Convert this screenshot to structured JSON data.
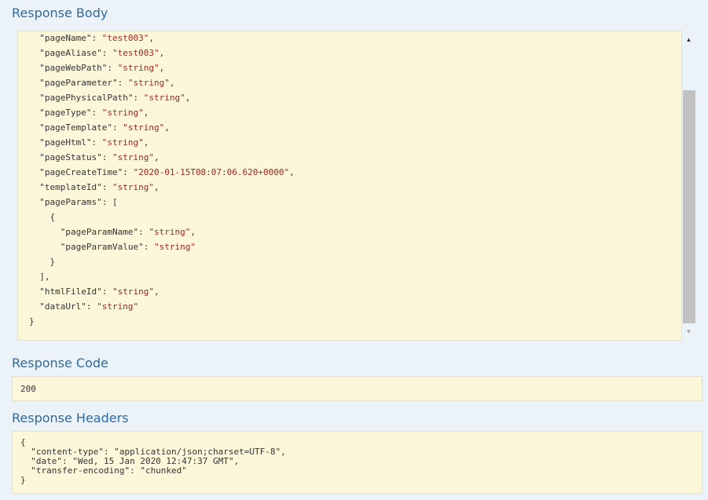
{
  "response_body": {
    "title": "Response Body",
    "lines": [
      {
        "indent": "  ",
        "key": "\"pageName\"",
        "sep": ": ",
        "value": "\"test003\"",
        "end": ","
      },
      {
        "indent": "  ",
        "key": "\"pageAliase\"",
        "sep": ": ",
        "value": "\"test003\"",
        "end": ","
      },
      {
        "indent": "  ",
        "key": "\"pageWebPath\"",
        "sep": ": ",
        "value": "\"string\"",
        "end": ","
      },
      {
        "indent": "  ",
        "key": "\"pageParameter\"",
        "sep": ": ",
        "value": "\"string\"",
        "end": ","
      },
      {
        "indent": "  ",
        "key": "\"pagePhysicalPath\"",
        "sep": ": ",
        "value": "\"string\"",
        "end": ","
      },
      {
        "indent": "  ",
        "key": "\"pageType\"",
        "sep": ": ",
        "value": "\"string\"",
        "end": ","
      },
      {
        "indent": "  ",
        "key": "\"pageTemplate\"",
        "sep": ": ",
        "value": "\"string\"",
        "end": ","
      },
      {
        "indent": "  ",
        "key": "\"pageHtml\"",
        "sep": ": ",
        "value": "\"string\"",
        "end": ","
      },
      {
        "indent": "  ",
        "key": "\"pageStatus\"",
        "sep": ": ",
        "value": "\"string\"",
        "end": ","
      },
      {
        "indent": "  ",
        "key": "\"pageCreateTime\"",
        "sep": ": ",
        "value": "\"2020-01-15T08:07:06.620+0000\"",
        "end": ","
      },
      {
        "indent": "  ",
        "key": "\"templateId\"",
        "sep": ": ",
        "value": "\"string\"",
        "end": ","
      },
      {
        "indent": "  ",
        "key": "\"pageParams\"",
        "sep": ": ",
        "value": "",
        "end": "["
      },
      {
        "indent": "    ",
        "key": "",
        "sep": "",
        "value": "",
        "end": "{"
      },
      {
        "indent": "      ",
        "key": "\"pageParamName\"",
        "sep": ": ",
        "value": "\"string\"",
        "end": ","
      },
      {
        "indent": "      ",
        "key": "\"pageParamValue\"",
        "sep": ": ",
        "value": "\"string\"",
        "end": ""
      },
      {
        "indent": "    ",
        "key": "",
        "sep": "",
        "value": "",
        "end": "}"
      },
      {
        "indent": "  ",
        "key": "",
        "sep": "",
        "value": "",
        "end": "],"
      },
      {
        "indent": "  ",
        "key": "\"htmlFileId\"",
        "sep": ": ",
        "value": "\"string\"",
        "end": ","
      },
      {
        "indent": "  ",
        "key": "\"dataUrl\"",
        "sep": ": ",
        "value": "\"string\"",
        "end": ""
      },
      {
        "indent": "",
        "key": "",
        "sep": "",
        "value": "",
        "end": "}"
      }
    ]
  },
  "response_code": {
    "title": "Response Code",
    "value": "200"
  },
  "response_headers": {
    "title": "Response Headers",
    "lines": [
      "{",
      "  \"content-type\": \"application/json;charset=UTF-8\",",
      "  \"date\": \"Wed, 15 Jan 2020 12:47:37 GMT\",",
      "  \"transfer-encoding\": \"chunked\"",
      "}"
    ]
  },
  "scrollbar": {
    "up_icon": "triangle-up-icon",
    "down_icon": "triangle-down-icon",
    "position": 0.22
  },
  "colors": {
    "background": "#ebf3f9",
    "title": "#2d6a9f",
    "code_background": "#fcf6db",
    "string_value": "#9b2a1c"
  }
}
